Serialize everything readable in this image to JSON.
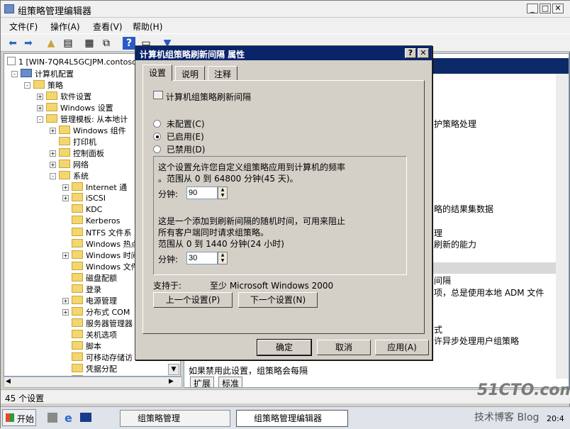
{
  "window": {
    "title": "组策略管理编辑器"
  },
  "menu": {
    "file": "文件(F)",
    "action": "操作(A)",
    "view": "查看(V)",
    "help": "帮助(H)"
  },
  "tree": {
    "root": "1 [WIN-7QR4L5GCJPM.contoso.",
    "items": [
      "计算机配置",
      "策略",
      "软件设置",
      "Windows 设置",
      "管理模板: 从本地计",
      "Windows 组件",
      "打印机",
      "控制面板",
      "网络",
      "系统",
      "Internet 通",
      "iSCSI",
      "KDC",
      "Kerberos",
      "NTFS 文件系",
      "Windows 热点",
      "Windows 时间",
      "Windows 文件",
      "磁盘配额",
      "登录",
      "电源管理",
      "分布式 COM",
      "服务器管理器",
      "关机选项",
      "脚本",
      "可移动存储访",
      "凭据分配",
      "远程过程调用"
    ]
  },
  "right_pane": {
    "lines": [
      "护策略处理",
      "略的结果集数据",
      "理",
      "刷新的能力",
      "间隔",
      "项，总是使用本地 ADM 文件",
      "式",
      "许异步处理用户组策略"
    ],
    "bottom_text": "如果禁用此设置，组策略会每隔",
    "tabs": [
      "扩展",
      "标准"
    ]
  },
  "status": {
    "text": "45 个设置"
  },
  "taskbar": {
    "start": "开始",
    "tasks": [
      "组策略管理",
      "组策略管理编辑器"
    ],
    "watermark": "51CTO.com",
    "watermark_sub": "技术博客 Blog",
    "clock": "20:4"
  },
  "dialog": {
    "title": "计算机组策略刷新间隔 属性",
    "tabs": [
      "设置",
      "说明",
      "注释"
    ],
    "setting_name": "计算机组策略刷新间隔",
    "options": {
      "not_configured": "未配置(C)",
      "enabled": "已启用(E)",
      "disabled": "已禁用(D)"
    },
    "selected": "enabled",
    "desc1_line1": "这个设置允许您自定义组策略应用到计算机的频率",
    "desc1_line2": "。范围从 0 到 64800 分钟(45 天)。",
    "minutes_label": "分钟:",
    "minutes_value": "90",
    "desc2_line1": "这是一个添加到刷新间隔的随机时间，可用来阻止",
    "desc2_line2": "所有客户端同时请求组策略。",
    "desc2_line3": "范围从 0 到 1440 分钟(24 小时)",
    "offset_label": "分钟:",
    "offset_value": "30",
    "supported_label": "支持于:",
    "supported_value": "至少 Microsoft Windows 2000",
    "prev_button": "上一个设置(P)",
    "next_button": "下一个设置(N)",
    "ok_button": "确定",
    "cancel_button": "取消",
    "apply_button": "应用(A)"
  }
}
